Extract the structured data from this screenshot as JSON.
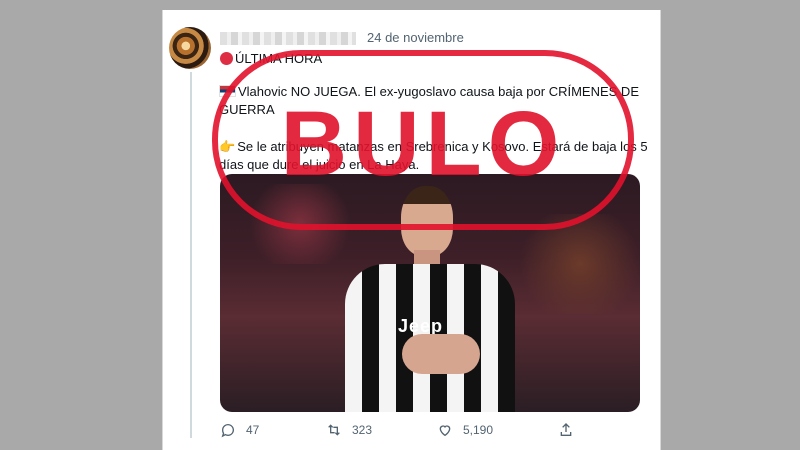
{
  "tweet": {
    "date": "24 de noviembre",
    "headline": "ÚLTIMA HORA",
    "paragraph1": "Vlahovic NO JUEGA. El ex-yugoslavo causa baja por CRÍMENES DE GUERRA",
    "paragraph2": "Se le atribuyen matanzas en Srebrenica y Kosovo. Estará de baja los 5 días que dure el juicio en La Haya.",
    "image_sponsor": "Jeep",
    "replies": "47",
    "retweets": "323",
    "likes": "5,190"
  },
  "stamp": {
    "text": "BULO",
    "color": "#e1122c"
  },
  "icons": {
    "more": "more-dots-icon",
    "reply": "reply-icon",
    "retweet": "retweet-icon",
    "like": "heart-icon",
    "share": "share-icon"
  }
}
